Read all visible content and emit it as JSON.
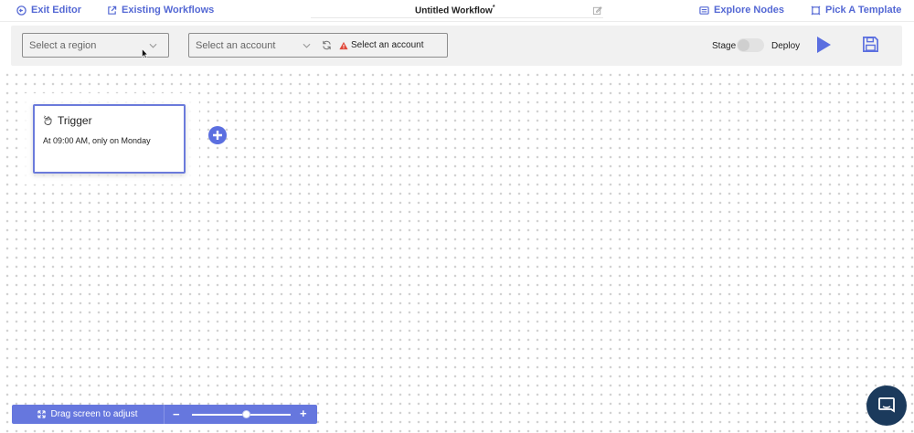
{
  "topbar": {
    "exit_label": "Exit Editor",
    "existing_label": "Existing Workflows",
    "workflow_title": "Untitled Workflow",
    "title_mark": "*",
    "explore_label": "Explore Nodes",
    "template_label": "Pick A Template"
  },
  "toolbar": {
    "region_placeholder": "Select a region",
    "account_placeholder": "Select an account",
    "account_warning": "Select an account",
    "stage_label": "Stage",
    "deploy_label": "Deploy",
    "stage_enabled": false
  },
  "canvas": {
    "trigger_node": {
      "title": "Trigger",
      "description": "At 09:00 AM, only on Monday"
    }
  },
  "zoom": {
    "drag_label": "Drag screen to adjust",
    "minus": "−",
    "plus": "+",
    "level": 0.55
  },
  "colors": {
    "accent": "#5468d4",
    "warning": "#e0483a",
    "chat": "#1b3a5c"
  },
  "icons": {
    "exit": "circle-arrow-icon",
    "existing": "external-link-icon",
    "edit": "pencil-icon",
    "explore": "list-icon",
    "template": "template-icon",
    "refresh": "refresh-icon",
    "warning": "warning-icon",
    "play": "play-icon",
    "save": "save-icon",
    "trigger": "pointer-hand-icon",
    "add": "plus-circle-icon",
    "drag": "expand-icon",
    "chat": "chat-icon"
  }
}
